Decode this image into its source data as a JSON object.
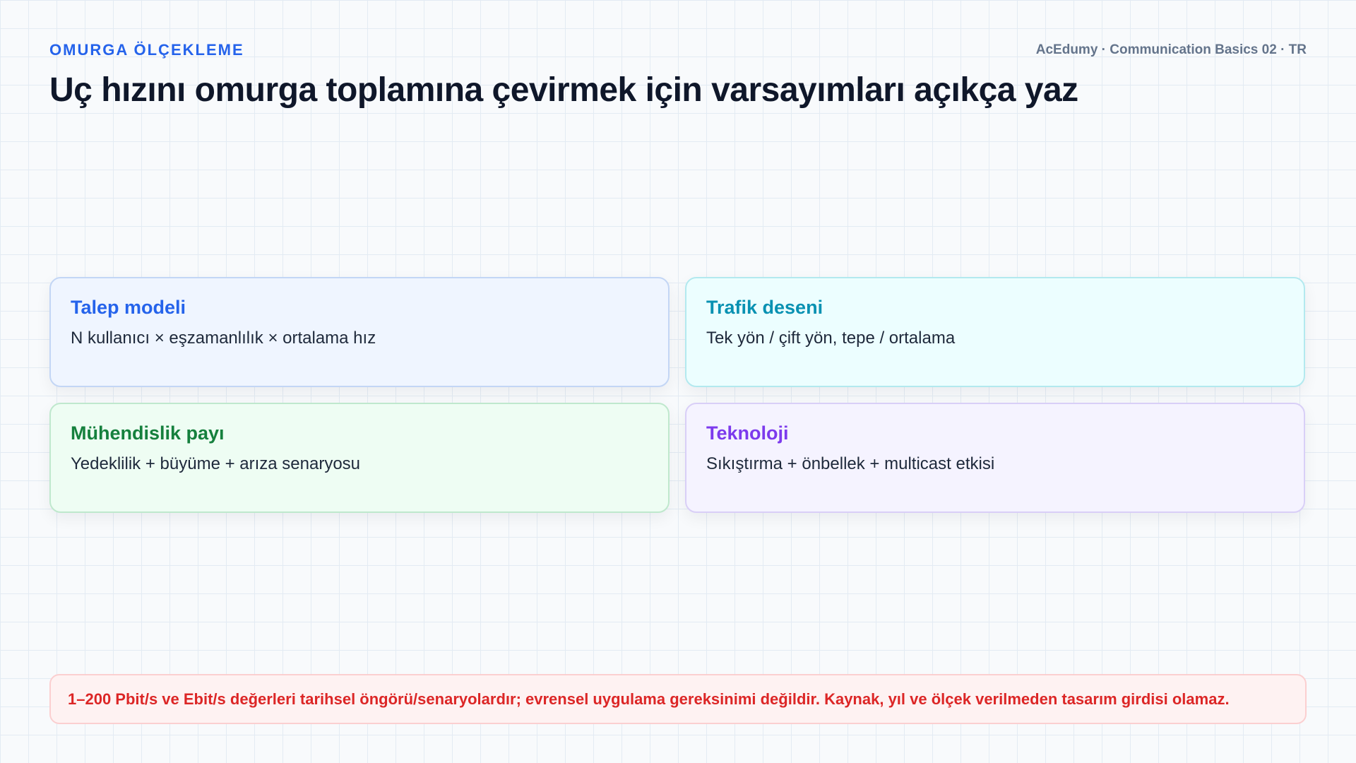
{
  "header": {
    "kicker": "OMURGA ÖLÇEKLEME",
    "meta": "AcEdumy · Communication Basics 02 · TR",
    "title": "Uç hızını omurga toplamına çevirmek için varsayımları açıkça yaz"
  },
  "cards": [
    {
      "title": "Talep modeli",
      "text": "N kullanıcı × eşzamanlılık × ortalama hız",
      "accent": "#2563eb"
    },
    {
      "title": "Trafik deseni",
      "text": "Tek yön / çift yön, tepe / ortalama",
      "accent": "#0891b2"
    },
    {
      "title": "Mühendislik payı",
      "text": "Yedeklilik + büyüme + arıza senaryosu",
      "accent": "#15803d"
    },
    {
      "title": "Teknoloji",
      "text": "Sıkıştırma + önbellek + multicast etkisi",
      "accent": "#7c3aed"
    }
  ],
  "warning": {
    "text": "1–200 Pbit/s ve Ebit/s değerleri tarihsel öngörü/senaryolardır; evrensel uygulama gereksinimi değildir. Kaynak, yıl ve ölçek verilmeden tasarım girdisi olamaz.",
    "color": "#dc2626"
  }
}
